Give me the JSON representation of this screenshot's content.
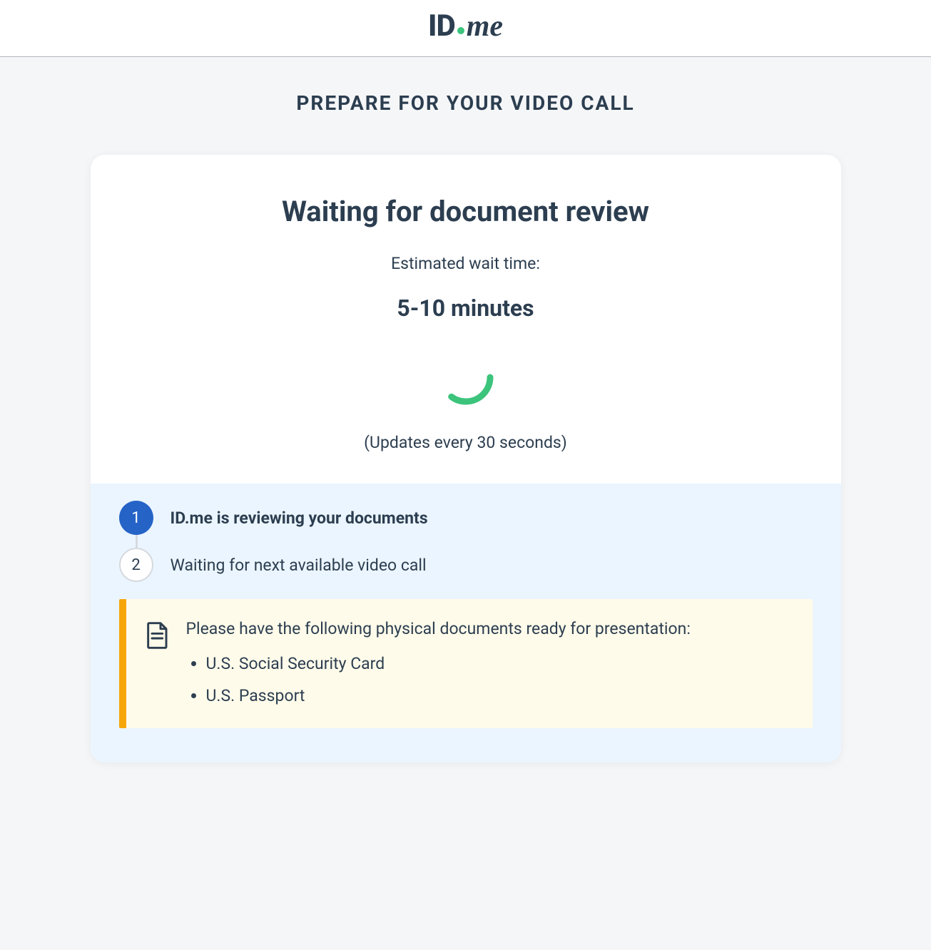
{
  "brand": {
    "id": "ID",
    "me": "me"
  },
  "page": {
    "title": "PREPARE FOR YOUR VIDEO CALL"
  },
  "status": {
    "heading": "Waiting for document review",
    "wait_label": "Estimated wait time:",
    "wait_value": "5-10 minutes",
    "update_note": "(Updates every 30 seconds)"
  },
  "steps": [
    {
      "number": "1",
      "label": "ID.me is reviewing your documents",
      "active": true
    },
    {
      "number": "2",
      "label": "Waiting for next available video call",
      "active": false
    }
  ],
  "callout": {
    "intro": "Please have the following physical documents ready for presentation:",
    "documents": [
      "U.S. Social Security Card",
      "U.S. Passport"
    ]
  },
  "colors": {
    "accent_blue": "#2563c7",
    "accent_green": "#3cc47c",
    "accent_amber": "#f6a609",
    "text": "#2c3e50",
    "panel_blue": "#ebf5ff",
    "panel_cream": "#fffbea"
  }
}
